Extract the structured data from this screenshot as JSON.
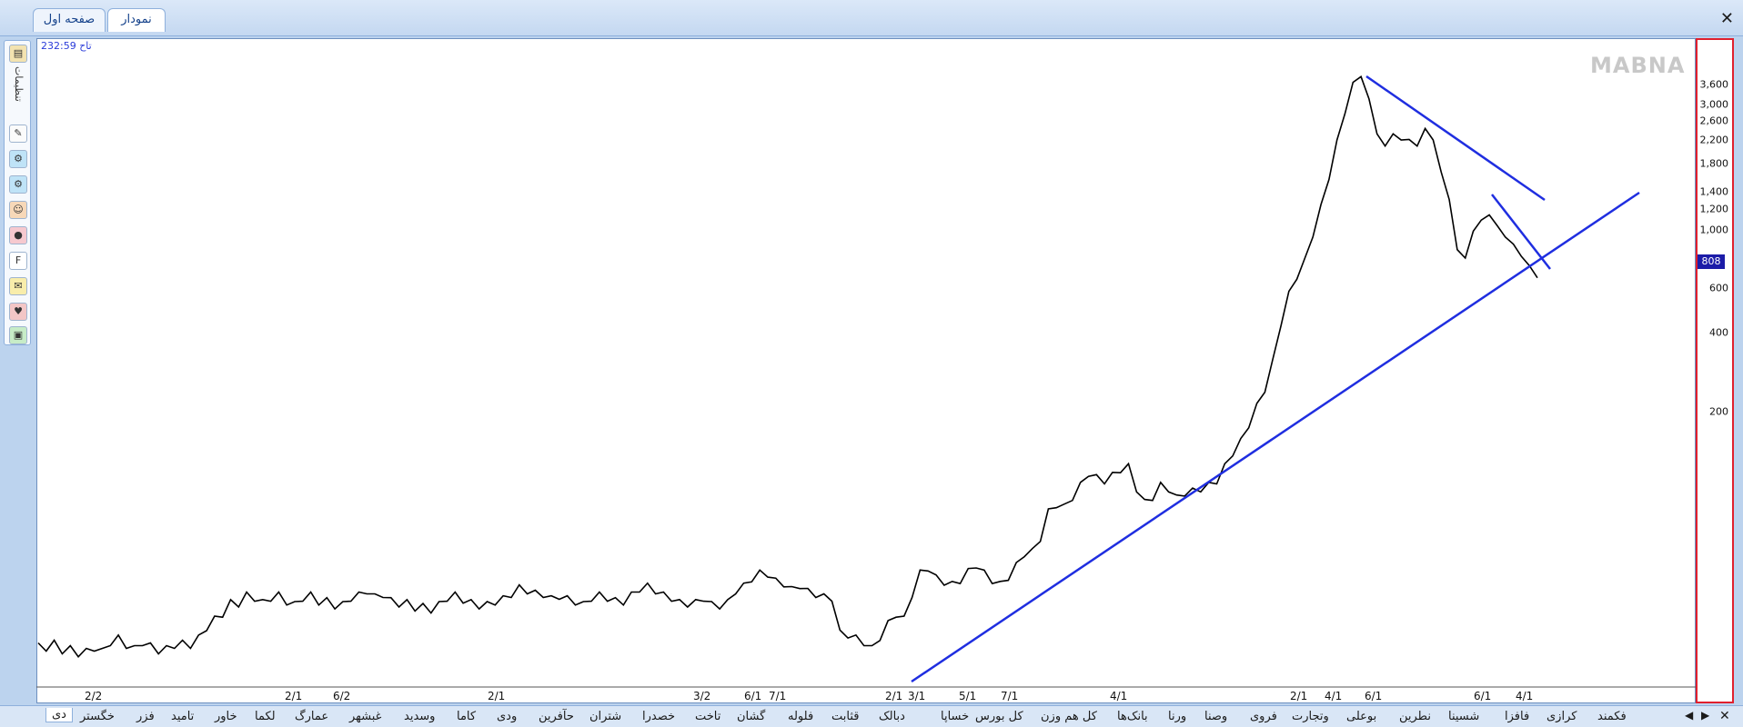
{
  "tabs": [
    {
      "label": "صفحه اول"
    },
    {
      "label": "نمودار"
    }
  ],
  "chart_header": {
    "time": "232:59 تاح",
    "watermark": "MABNA"
  },
  "toolbar": {
    "vertical_label": "تنظیمات"
  },
  "current_price": "808",
  "chart_data": {
    "type": "line",
    "scale": "log",
    "grid": false,
    "ylim": [
      40,
      4000
    ],
    "y_ticks": [
      "3,600",
      "3,000",
      "2,600",
      "2,200",
      "1,800",
      "1,400",
      "1,200",
      "1,000",
      "600",
      "400",
      "200"
    ],
    "y_tick_values": [
      3600,
      3000,
      2600,
      2200,
      1800,
      1400,
      1200,
      1000,
      600,
      400,
      200
    ],
    "x_tick_labels": [
      "2/2",
      "2/1",
      "6/2",
      "2/1",
      "3/2",
      "6/1",
      "7/1",
      "2/1",
      "3/1",
      "5/1",
      "7/1",
      "4/1",
      "2/1",
      "4/1",
      "6/1",
      "6/1",
      "4/1"
    ],
    "series": [
      {
        "values": [
          49,
          48,
          50,
          47,
          48,
          46,
          47,
          48,
          47,
          50,
          52,
          49,
          48,
          50,
          49,
          47,
          48,
          49,
          50,
          49,
          52,
          56,
          60,
          62,
          68,
          67,
          72,
          70,
          68,
          70,
          72,
          68,
          67,
          70,
          72,
          68,
          69,
          66,
          67,
          70,
          72,
          74,
          71,
          72,
          69,
          67,
          68,
          65,
          66,
          64,
          67,
          70,
          72,
          69,
          68,
          66,
          67,
          68,
          70,
          72,
          76,
          74,
          73,
          72,
          70,
          71,
          70,
          68,
          67,
          70,
          72,
          70,
          69,
          68,
          72,
          75,
          77,
          74,
          72,
          70,
          68,
          67,
          68,
          70,
          67,
          66,
          68,
          74,
          77,
          81,
          85,
          84,
          80,
          78,
          75,
          77,
          74,
          72,
          71,
          70,
          54,
          53,
          52,
          50,
          48,
          52,
          58,
          62,
          60,
          72,
          85,
          88,
          82,
          79,
          78,
          80,
          86,
          90,
          85,
          80,
          78,
          82,
          90,
          98,
          100,
          110,
          135,
          142,
          140,
          150,
          165,
          180,
          175,
          170,
          178,
          185,
          190,
          160,
          145,
          150,
          165,
          160,
          150,
          155,
          158,
          160,
          165,
          170,
          190,
          210,
          230,
          260,
          300,
          340,
          420,
          560,
          700,
          800,
          900,
          1100,
          1350,
          1700,
          2200,
          2800,
          3400,
          3700,
          3000,
          2400,
          2100,
          2400,
          2200,
          2300,
          2100,
          2500,
          2200,
          1800,
          1400,
          1000,
          900,
          1150,
          1200,
          1300,
          1150,
          1100,
          1000,
          950,
          850,
          808
        ]
      }
    ],
    "trendlines": [
      {
        "from": [
          0.0,
          38
        ],
        "to": [
          1.0,
          1400
        ]
      },
      {
        "from": [
          0.0,
          3700
        ],
        "to": [
          1.0,
          1300
        ]
      },
      {
        "from": [
          0.0,
          1370
        ],
        "to": [
          1.0,
          720
        ]
      }
    ]
  },
  "symbols": [
    "دی",
    "خگستر",
    "فزر",
    "تامید",
    "خاور",
    "لکما",
    "عمارگ",
    "غبشهر",
    "وسدید",
    "کاما",
    "ودی",
    "حآفرین",
    "شتران",
    "خصدرا",
    "تاخت",
    "گشان",
    "فلوله",
    "قثابت",
    "دبالک",
    "خساپا",
    "کل بورس",
    "کل هم وزن",
    "بانک‌ها",
    "ورنا",
    "وصنا",
    "فروی",
    "وتجارت",
    "بوعلی",
    "نطرین",
    "شسینا",
    "فافزا",
    "کرازی",
    "فکمند"
  ],
  "nav": {
    "prev": "◀",
    "next": "▶",
    "close": "✕"
  },
  "window": {
    "close": "✕"
  }
}
